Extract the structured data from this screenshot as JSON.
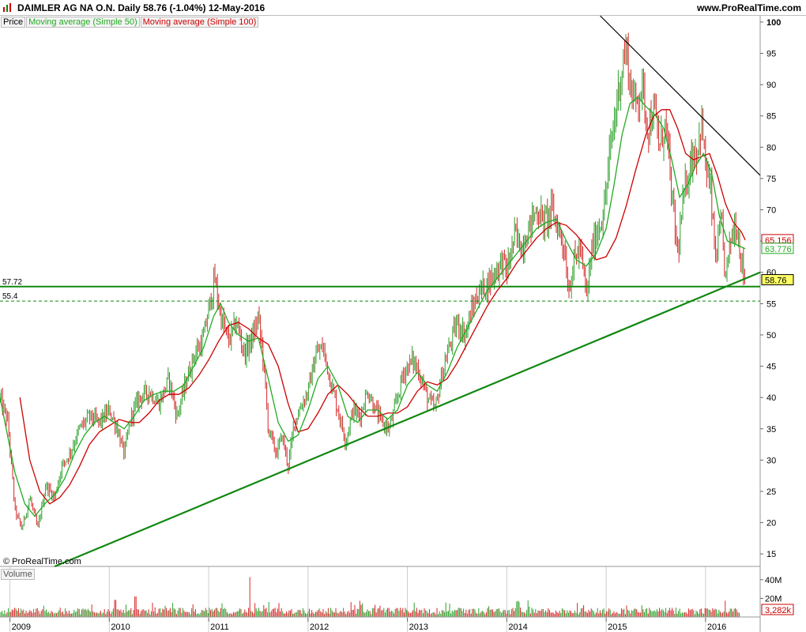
{
  "header": {
    "title": "DAIMLER AG NA O.N.   Daily   58.76 (-1.04%)   12-May-2016",
    "site": "www.ProRealTime.com"
  },
  "legend": [
    {
      "label": "Price",
      "color": "#000000"
    },
    {
      "label": "Moving average (Simple 50)",
      "color": "#22aa22"
    },
    {
      "label": "Moving average (Simple 100)",
      "color": "#cc0000"
    }
  ],
  "volume_label": "Volume",
  "copyright": "© ProRealTime.com",
  "colors": {
    "up": "#2ca02c",
    "down": "#d62728",
    "ma50": "#22aa22",
    "ma100": "#cc0000",
    "trend_support": "#118811",
    "trend_resist": "#000000"
  },
  "chart_data": {
    "type": "line",
    "title": "DAIMLER AG NA O.N.",
    "y_ticks": [
      15,
      20,
      25,
      30,
      35,
      40,
      45,
      50,
      55,
      60,
      65,
      70,
      75,
      80,
      85,
      90,
      95,
      100
    ],
    "ylim": [
      13,
      101
    ],
    "x_ticks": [
      "2009",
      "2010",
      "2011",
      "2012",
      "2013",
      "2014",
      "2015",
      "2016"
    ],
    "xlim": [
      2008.9,
      2016.55
    ],
    "price_path": [
      [
        2008.9,
        40
      ],
      [
        2008.98,
        36
      ],
      [
        2009.05,
        22
      ],
      [
        2009.12,
        19
      ],
      [
        2009.2,
        24
      ],
      [
        2009.28,
        19
      ],
      [
        2009.36,
        26
      ],
      [
        2009.45,
        24
      ],
      [
        2009.52,
        29
      ],
      [
        2009.6,
        31
      ],
      [
        2009.7,
        35
      ],
      [
        2009.8,
        37
      ],
      [
        2009.9,
        36
      ],
      [
        2010.0,
        38
      ],
      [
        2010.08,
        35
      ],
      [
        2010.15,
        31
      ],
      [
        2010.22,
        37
      ],
      [
        2010.3,
        40
      ],
      [
        2010.4,
        41
      ],
      [
        2010.5,
        39
      ],
      [
        2010.6,
        43
      ],
      [
        2010.68,
        37
      ],
      [
        2010.78,
        43
      ],
      [
        2010.86,
        47
      ],
      [
        2010.94,
        49
      ],
      [
        2011.0,
        54
      ],
      [
        2011.06,
        59
      ],
      [
        2011.12,
        53
      ],
      [
        2011.2,
        49
      ],
      [
        2011.28,
        52
      ],
      [
        2011.36,
        47
      ],
      [
        2011.45,
        50
      ],
      [
        2011.5,
        53
      ],
      [
        2011.55,
        46
      ],
      [
        2011.6,
        35
      ],
      [
        2011.68,
        31
      ],
      [
        2011.74,
        34
      ],
      [
        2011.8,
        29
      ],
      [
        2011.86,
        36
      ],
      [
        2011.94,
        39
      ],
      [
        2012.0,
        41
      ],
      [
        2012.08,
        47
      ],
      [
        2012.15,
        48
      ],
      [
        2012.22,
        43
      ],
      [
        2012.3,
        38
      ],
      [
        2012.38,
        33
      ],
      [
        2012.45,
        38
      ],
      [
        2012.52,
        37
      ],
      [
        2012.6,
        41
      ],
      [
        2012.68,
        38
      ],
      [
        2012.74,
        36
      ],
      [
        2012.82,
        35
      ],
      [
        2012.9,
        40
      ],
      [
        2012.96,
        44
      ],
      [
        2013.05,
        46
      ],
      [
        2013.12,
        44
      ],
      [
        2013.2,
        40
      ],
      [
        2013.28,
        38
      ],
      [
        2013.35,
        44
      ],
      [
        2013.42,
        48
      ],
      [
        2013.5,
        52
      ],
      [
        2013.58,
        50
      ],
      [
        2013.65,
        54
      ],
      [
        2013.72,
        57
      ],
      [
        2013.8,
        58
      ],
      [
        2013.88,
        60
      ],
      [
        2013.96,
        62
      ],
      [
        2014.0,
        60
      ],
      [
        2014.08,
        66
      ],
      [
        2014.15,
        64
      ],
      [
        2014.22,
        67
      ],
      [
        2014.3,
        70
      ],
      [
        2014.38,
        68
      ],
      [
        2014.45,
        70
      ],
      [
        2014.52,
        67
      ],
      [
        2014.58,
        64
      ],
      [
        2014.62,
        57
      ],
      [
        2014.68,
        62
      ],
      [
        2014.74,
        64
      ],
      [
        2014.8,
        56
      ],
      [
        2014.86,
        64
      ],
      [
        2014.92,
        67
      ],
      [
        2014.98,
        70
      ],
      [
        2015.03,
        78
      ],
      [
        2015.08,
        84
      ],
      [
        2015.14,
        91
      ],
      [
        2015.2,
        96
      ],
      [
        2015.25,
        89
      ],
      [
        2015.3,
        87
      ],
      [
        2015.36,
        90
      ],
      [
        2015.42,
        83
      ],
      [
        2015.48,
        86
      ],
      [
        2015.54,
        80
      ],
      [
        2015.6,
        84
      ],
      [
        2015.66,
        72
      ],
      [
        2015.72,
        63
      ],
      [
        2015.78,
        72
      ],
      [
        2015.85,
        78
      ],
      [
        2015.92,
        80
      ],
      [
        2015.96,
        84
      ],
      [
        2016.0,
        77
      ],
      [
        2016.05,
        73
      ],
      [
        2016.1,
        62
      ],
      [
        2016.16,
        68
      ],
      [
        2016.2,
        59
      ],
      [
        2016.26,
        66
      ],
      [
        2016.31,
        68
      ],
      [
        2016.36,
        62
      ],
      [
        2016.4,
        58.76
      ]
    ],
    "ma50": [
      [
        2008.9,
        40
      ],
      [
        2009.05,
        28
      ],
      [
        2009.15,
        23
      ],
      [
        2009.25,
        21
      ],
      [
        2009.35,
        23
      ],
      [
        2009.45,
        24.5
      ],
      [
        2009.55,
        27
      ],
      [
        2009.65,
        31
      ],
      [
        2009.75,
        34
      ],
      [
        2009.85,
        36
      ],
      [
        2009.95,
        37
      ],
      [
        2010.05,
        36
      ],
      [
        2010.15,
        35
      ],
      [
        2010.25,
        37
      ],
      [
        2010.35,
        39.5
      ],
      [
        2010.45,
        40.5
      ],
      [
        2010.55,
        41
      ],
      [
        2010.65,
        41
      ],
      [
        2010.75,
        42
      ],
      [
        2010.85,
        45
      ],
      [
        2010.95,
        48
      ],
      [
        2011.05,
        53
      ],
      [
        2011.12,
        55
      ],
      [
        2011.2,
        52
      ],
      [
        2011.3,
        50
      ],
      [
        2011.4,
        49
      ],
      [
        2011.5,
        49.5
      ],
      [
        2011.6,
        43
      ],
      [
        2011.7,
        36
      ],
      [
        2011.8,
        33
      ],
      [
        2011.9,
        34
      ],
      [
        2012.0,
        38
      ],
      [
        2012.1,
        43
      ],
      [
        2012.2,
        45
      ],
      [
        2012.3,
        42
      ],
      [
        2012.4,
        37
      ],
      [
        2012.5,
        36
      ],
      [
        2012.6,
        38
      ],
      [
        2012.7,
        38
      ],
      [
        2012.8,
        36.5
      ],
      [
        2012.9,
        38
      ],
      [
        2013.0,
        42
      ],
      [
        2013.1,
        44
      ],
      [
        2013.2,
        42
      ],
      [
        2013.3,
        41
      ],
      [
        2013.4,
        44
      ],
      [
        2013.5,
        48
      ],
      [
        2013.6,
        51
      ],
      [
        2013.7,
        54
      ],
      [
        2013.8,
        57
      ],
      [
        2013.9,
        59
      ],
      [
        2014.0,
        61
      ],
      [
        2014.1,
        63
      ],
      [
        2014.2,
        65
      ],
      [
        2014.3,
        67
      ],
      [
        2014.4,
        68
      ],
      [
        2014.5,
        68.5
      ],
      [
        2014.6,
        65
      ],
      [
        2014.7,
        62
      ],
      [
        2014.8,
        61
      ],
      [
        2014.9,
        63
      ],
      [
        2015.0,
        67
      ],
      [
        2015.08,
        74
      ],
      [
        2015.16,
        82
      ],
      [
        2015.24,
        87
      ],
      [
        2015.32,
        88
      ],
      [
        2015.4,
        86.5
      ],
      [
        2015.5,
        85
      ],
      [
        2015.58,
        83
      ],
      [
        2015.66,
        78
      ],
      [
        2015.74,
        72
      ],
      [
        2015.82,
        74
      ],
      [
        2015.9,
        77
      ],
      [
        2015.98,
        79
      ],
      [
        2016.06,
        76
      ],
      [
        2016.14,
        69
      ],
      [
        2016.22,
        65
      ],
      [
        2016.3,
        64.5
      ],
      [
        2016.4,
        63.776
      ]
    ],
    "ma100": [
      [
        2009.1,
        40
      ],
      [
        2009.2,
        30
      ],
      [
        2009.3,
        25
      ],
      [
        2009.4,
        23
      ],
      [
        2009.5,
        24
      ],
      [
        2009.6,
        26
      ],
      [
        2009.7,
        29
      ],
      [
        2009.8,
        32.5
      ],
      [
        2009.9,
        34.5
      ],
      [
        2010.0,
        35.5
      ],
      [
        2010.1,
        36.5
      ],
      [
        2010.2,
        36
      ],
      [
        2010.3,
        36
      ],
      [
        2010.4,
        37.5
      ],
      [
        2010.5,
        39.5
      ],
      [
        2010.6,
        40.5
      ],
      [
        2010.7,
        40.5
      ],
      [
        2010.8,
        41.5
      ],
      [
        2010.9,
        43.5
      ],
      [
        2011.0,
        46
      ],
      [
        2011.1,
        49
      ],
      [
        2011.2,
        51.5
      ],
      [
        2011.3,
        52
      ],
      [
        2011.4,
        51
      ],
      [
        2011.5,
        49.5
      ],
      [
        2011.6,
        48.5
      ],
      [
        2011.7,
        45
      ],
      [
        2011.8,
        39
      ],
      [
        2011.9,
        34.5
      ],
      [
        2012.0,
        35
      ],
      [
        2012.1,
        37.5
      ],
      [
        2012.2,
        40.5
      ],
      [
        2012.3,
        42
      ],
      [
        2012.4,
        40.5
      ],
      [
        2012.5,
        38.5
      ],
      [
        2012.6,
        37
      ],
      [
        2012.7,
        37
      ],
      [
        2012.8,
        37.5
      ],
      [
        2012.9,
        37.5
      ],
      [
        2013.0,
        38.5
      ],
      [
        2013.1,
        41
      ],
      [
        2013.2,
        42.5
      ],
      [
        2013.3,
        42
      ],
      [
        2013.4,
        43
      ],
      [
        2013.5,
        45.5
      ],
      [
        2013.6,
        48.5
      ],
      [
        2013.7,
        51.5
      ],
      [
        2013.8,
        54.5
      ],
      [
        2013.9,
        57
      ],
      [
        2014.0,
        59
      ],
      [
        2014.1,
        61.5
      ],
      [
        2014.2,
        63.5
      ],
      [
        2014.3,
        65.5
      ],
      [
        2014.4,
        67
      ],
      [
        2014.5,
        68
      ],
      [
        2014.6,
        67.5
      ],
      [
        2014.7,
        66
      ],
      [
        2014.8,
        64
      ],
      [
        2014.9,
        62
      ],
      [
        2015.0,
        62.5
      ],
      [
        2015.1,
        65.5
      ],
      [
        2015.2,
        70.5
      ],
      [
        2015.3,
        76.5
      ],
      [
        2015.4,
        82
      ],
      [
        2015.48,
        85
      ],
      [
        2015.56,
        86
      ],
      [
        2015.64,
        86
      ],
      [
        2015.72,
        83
      ],
      [
        2015.8,
        79
      ],
      [
        2015.88,
        78
      ],
      [
        2015.96,
        78.5
      ],
      [
        2016.04,
        79
      ],
      [
        2016.12,
        75.5
      ],
      [
        2016.2,
        71
      ],
      [
        2016.28,
        68
      ],
      [
        2016.36,
        66.5
      ],
      [
        2016.4,
        65.156
      ]
    ],
    "support_trend": [
      [
        2009.45,
        13
      ],
      [
        2016.55,
        60
      ]
    ],
    "resistance_trend": [
      [
        2014.94,
        101
      ],
      [
        2016.55,
        75.5
      ]
    ],
    "horizontal_levels": [
      {
        "value": 57.72,
        "label": "57.72",
        "style": "solid"
      },
      {
        "value": 55.4,
        "label": "55.4",
        "style": "dashed"
      }
    ],
    "last_values": [
      {
        "label": "65.156",
        "value": 65.156,
        "color": "#cc0000"
      },
      {
        "label": "63.776",
        "value": 63.776,
        "color": "#22aa22"
      },
      {
        "label": "58.76",
        "value": 58.76,
        "color": "#000000",
        "bg": "#ffff66"
      }
    ],
    "volume": {
      "y_ticks": [
        "40M",
        "20M"
      ],
      "last_label": "3,282k",
      "ylim": [
        0,
        50
      ]
    }
  }
}
